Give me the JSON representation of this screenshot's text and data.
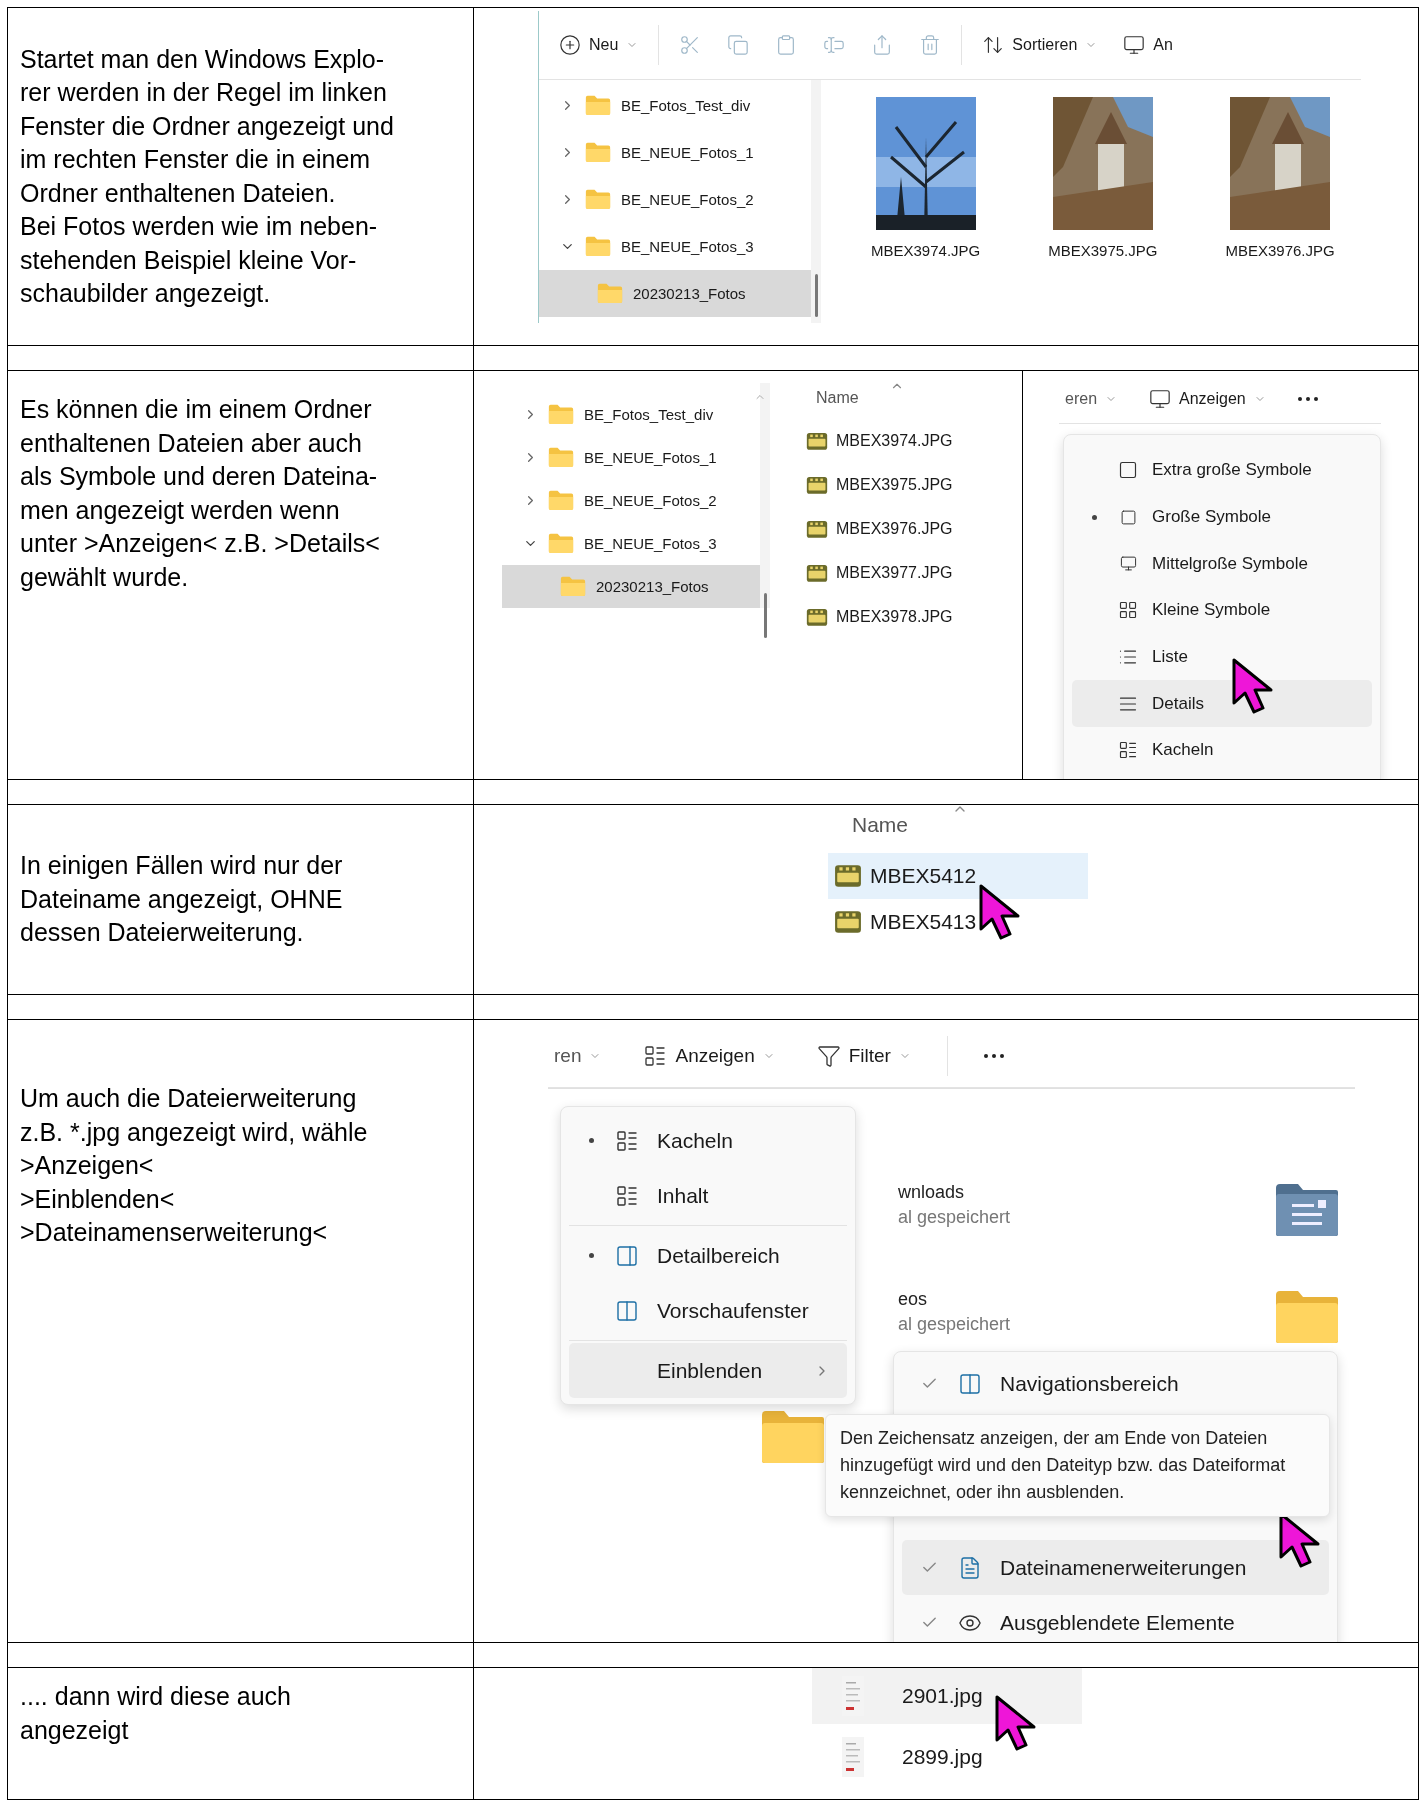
{
  "rows": [
    {
      "kind": "thumbnails",
      "description": [
        "Startet man den Windows Explo-",
        "rer werden in der Regel im linken",
        "Fenster die Ordner angezeigt und",
        "im rechten Fenster die in einem",
        "Ordner enthaltenen Dateien.",
        "Bei Fotos werden wie im neben-",
        "stehenden Beispiel kleine Vor-",
        "schaubilder angezeigt."
      ],
      "toolbar": [
        {
          "kind": "new",
          "label": "Neu",
          "disabled": false
        },
        {
          "kind": "cut",
          "disabled": true
        },
        {
          "kind": "copy",
          "disabled": true
        },
        {
          "kind": "paste",
          "disabled": true
        },
        {
          "kind": "rename",
          "disabled": true
        },
        {
          "kind": "share",
          "disabled": true
        },
        {
          "kind": "delete",
          "disabled": true
        },
        {
          "kind": "sort",
          "label": "Sortieren",
          "disabled": false
        },
        {
          "kind": "view",
          "label": "An",
          "disabled": false
        }
      ],
      "tree": [
        {
          "label": "BE_Fotos_Test_div",
          "expanded": false,
          "selected": false
        },
        {
          "label": "BE_NEUE_Fotos_1",
          "expanded": false,
          "selected": false
        },
        {
          "label": "BE_NEUE_Fotos_2",
          "expanded": false,
          "selected": false
        },
        {
          "label": "BE_NEUE_Fotos_3",
          "expanded": true,
          "selected": false,
          "children": [
            {
              "label": "20230213_Fotos",
              "selected": true
            }
          ]
        }
      ],
      "files": [
        {
          "name": "MBEX3974.JPG"
        },
        {
          "name": "MBEX3975.JPG"
        },
        {
          "name": "MBEX3976.JPG"
        }
      ]
    },
    {
      "kind": "details",
      "description": [
        "Es können die im einem Ordner",
        "enthaltenen Dateien aber auch",
        "als Symbole und deren Dateina-",
        "men angezeigt werden wenn",
        "unter >Anzeigen< z.B. >Details<",
        "gewählt wurde."
      ],
      "tree": [
        {
          "label": "BE_Fotos_Test_div",
          "expanded": false,
          "selected": false
        },
        {
          "label": "BE_NEUE_Fotos_1",
          "expanded": false,
          "selected": false
        },
        {
          "label": "BE_NEUE_Fotos_2",
          "expanded": false,
          "selected": false
        },
        {
          "label": "BE_NEUE_Fotos_3",
          "expanded": true,
          "selected": false,
          "children": [
            {
              "label": "20230213_Fotos",
              "selected": true
            }
          ]
        }
      ],
      "list": {
        "header": "Name",
        "files": [
          {
            "name": "MBEX3974.JPG",
            "selected": false
          },
          {
            "name": "MBEX3975.JPG",
            "selected": false
          },
          {
            "name": "MBEX3976.JPG",
            "selected": false
          },
          {
            "name": "MBEX3977.JPG",
            "selected": false
          },
          {
            "name": "MBEX3978.JPG",
            "selected": false
          }
        ]
      },
      "toolbar": [
        {
          "kind": "text",
          "label": "eren"
        },
        {
          "kind": "view",
          "label": "Anzeigen"
        },
        {
          "kind": "more"
        }
      ],
      "menu": [
        {
          "kind": "extra-large",
          "label": "Extra große Symbole",
          "selected": false,
          "highlighted": false
        },
        {
          "kind": "large",
          "label": "Große Symbole",
          "selected": true,
          "highlighted": false
        },
        {
          "kind": "medium",
          "label": "Mittelgroße Symbole",
          "selected": false,
          "highlighted": false
        },
        {
          "kind": "small",
          "label": "Kleine Symbole",
          "selected": false,
          "highlighted": false
        },
        {
          "kind": "list",
          "label": "Liste",
          "selected": false,
          "highlighted": false
        },
        {
          "kind": "details",
          "label": "Details",
          "selected": false,
          "highlighted": true
        },
        {
          "kind": "tiles",
          "label": "Kacheln",
          "selected": false,
          "highlighted": false
        }
      ]
    },
    {
      "kind": "names",
      "description": [
        "In einigen Fällen wird nur der",
        "Dateiname angezeigt, OHNE",
        "dessen Dateierweiterung."
      ],
      "list": {
        "header": "Name",
        "files": [
          {
            "name": "MBEX5412",
            "selected": true
          },
          {
            "name": "MBEX5413",
            "selected": false
          }
        ]
      }
    },
    {
      "kind": "show_menu",
      "description": [
        "Um auch die Dateierweiterung",
        "z.B. *.jpg angezeigt wird, wähle",
        ">Anzeigen<",
        ">Einblenden<",
        ">Dateinamenserweiterung<"
      ],
      "toolbar": [
        {
          "kind": "text",
          "label": "ren"
        },
        {
          "kind": "tiles",
          "label": "Anzeigen"
        },
        {
          "kind": "filter",
          "label": "Filter"
        },
        {
          "kind": "more"
        }
      ],
      "background": [
        {
          "kind": "documents",
          "title": "wnloads",
          "subtitle": "al gespeichert"
        },
        {
          "kind": "folder",
          "title": "eos",
          "subtitle": "al gespeichert"
        }
      ],
      "menu_groups": [
        [
          {
            "kind": "tiles",
            "label": "Kacheln",
            "selected": true,
            "highlighted": false
          },
          {
            "kind": "content",
            "label": "Inhalt",
            "selected": false,
            "highlighted": false
          }
        ],
        [
          {
            "kind": "details-pane",
            "label": "Detailbereich",
            "selected": true,
            "highlighted": false
          },
          {
            "kind": "preview-pane",
            "label": "Vorschaufenster",
            "selected": false,
            "highlighted": false
          }
        ],
        [
          {
            "kind": "submenu",
            "label": "Einblenden",
            "selected": false,
            "highlighted": true
          }
        ]
      ],
      "submenu": [
        {
          "kind": "navigation-pane",
          "label": "Navigationsbereich",
          "checked": true,
          "highlighted": false
        },
        {
          "kind": "extensions",
          "label": "Dateinamenerweiterungen",
          "checked": true,
          "highlighted": true
        },
        {
          "kind": "hidden",
          "label": "Ausgeblendete Elemente",
          "checked": true,
          "highlighted": false
        }
      ],
      "tooltip": "Den Zeichensatz anzeigen, der am Ende von Dateien hinzugefügt wird und den Dateityp bzw. das Dateiformat kennzeichnet, oder ihn ausblenden."
    },
    {
      "kind": "extensions",
      "description": [
        ".... dann wird diese auch",
        "angezeigt"
      ],
      "files": [
        {
          "name": "2901.jpg",
          "selected": true
        },
        {
          "name": "2899.jpg",
          "selected": false
        }
      ]
    }
  ]
}
